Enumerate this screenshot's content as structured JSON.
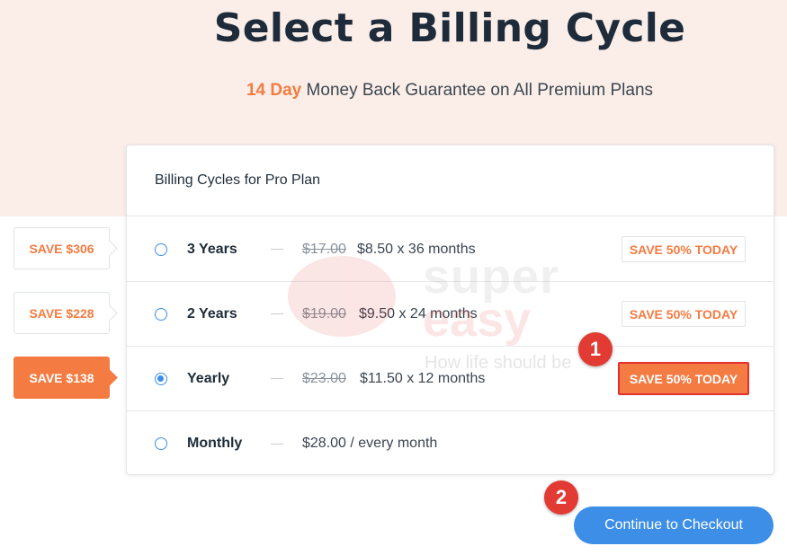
{
  "header": {
    "title": "Select a Billing Cycle",
    "guarantee_accent": "14 Day",
    "guarantee_text": " Money Back Guarantee on All Premium Plans"
  },
  "card": {
    "heading": "Billing Cycles for Pro Plan",
    "options": [
      {
        "label": "3 Years",
        "old_price": "$17.00",
        "new_price": "$8.50 x 36 months",
        "save_today": "SAVE 50% TODAY",
        "save_tab": "SAVE $306",
        "selected": false
      },
      {
        "label": "2 Years",
        "old_price": "$19.00",
        "new_price": "$9.50 x 24 months",
        "save_today": "SAVE 50% TODAY",
        "save_tab": "SAVE $228",
        "selected": false
      },
      {
        "label": "Yearly",
        "old_price": "$23.00",
        "new_price": "$11.50 x 12 months",
        "save_today": "SAVE 50% TODAY",
        "save_tab": "SAVE $138",
        "selected": true
      },
      {
        "label": "Monthly",
        "old_price": "",
        "new_price": "$28.00 / every month",
        "save_today": "",
        "save_tab": "",
        "selected": false
      }
    ]
  },
  "watermark": {
    "line1": "super",
    "line2": "easy",
    "tagline": "How life should be"
  },
  "annotations": {
    "step1": "1",
    "step2": "2"
  },
  "checkout": {
    "label": "Continue to Checkout"
  },
  "colors": {
    "accent": "#f47b42",
    "primary": "#3c8ee6",
    "hero_bg": "#fbeee8",
    "marker": "#e23b33"
  }
}
